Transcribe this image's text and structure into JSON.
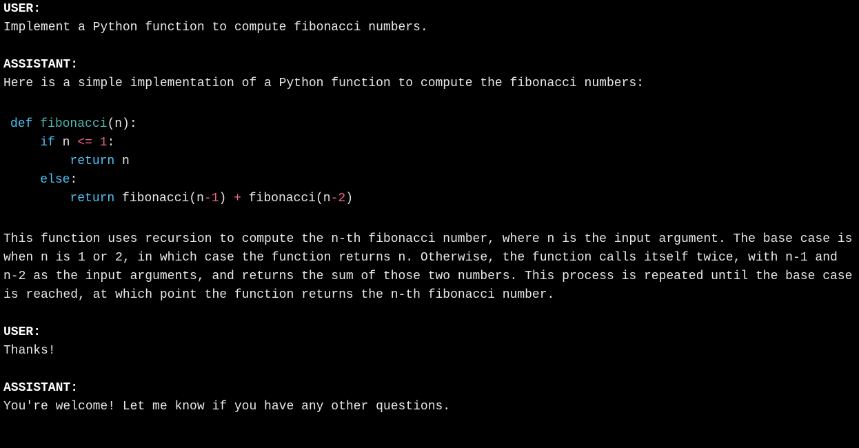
{
  "conversation": {
    "turns": [
      {
        "role": "USER:",
        "text": "Implement a Python function to compute fibonacci numbers."
      },
      {
        "role": "ASSISTANT:",
        "intro": "Here is a simple implementation of a Python function to compute the fibonacci numbers:",
        "explanation": "This function uses recursion to compute the n-th fibonacci number, where n is the input argument. The base case is when n is 1 or 2, in which case the function returns n. Otherwise, the function calls itself twice, with n-1 and n-2 as the input arguments, and returns the sum of those two numbers. This process is repeated until the base case is reached, at which point the function returns the n-th fibonacci number."
      },
      {
        "role": "USER:",
        "text": "Thanks!"
      },
      {
        "role": "ASSISTANT:",
        "text": "You're welcome! Let me know if you have any other questions."
      }
    ]
  },
  "code": {
    "kw_def": "def",
    "fn_name": "fibonacci",
    "param_open": "(n):",
    "kw_if": "if",
    "if_cond_var": " n ",
    "op_lte": "<=",
    "sp": " ",
    "num_1": "1",
    "colon": ":",
    "kw_return": "return",
    "ret_n": " n",
    "kw_else": "else",
    "else_colon": ":",
    "call1_name": "fibonacci",
    "call1_open": "(n",
    "op_minus": "-",
    "call1_close": ")",
    "op_plus": "+",
    "call2_name": "fibonacci",
    "call2_open": "(n",
    "num_2": "2",
    "call2_close": ")"
  }
}
